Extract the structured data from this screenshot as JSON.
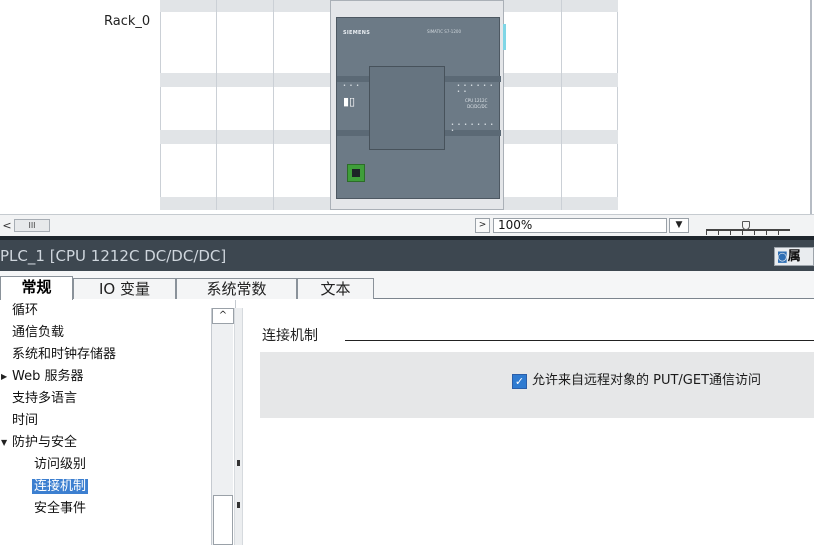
{
  "device_view": {
    "rack_label": "Rack_0",
    "cpu_module": {
      "brand": "SIEMENS",
      "series": "SIMATIC S7-1200",
      "model_line1": "CPU 1212C",
      "model_line2": "DC/DC/DC",
      "icon": "plc-module-icon"
    }
  },
  "scroll_bar": {
    "left_arrow": "<",
    "thumb_label": "III",
    "right_arrow": ">",
    "zoom_value": "100%",
    "zoom_dropdown_arrow": "▼",
    "zoom_slider_fraction": 0.45
  },
  "inspector": {
    "title": "PLC_1 [CPU 1212C DC/DC/DC]",
    "properties_button_label": "属",
    "tabs": [
      {
        "label": "常规",
        "active": true
      },
      {
        "label": "IO 变量",
        "active": false
      },
      {
        "label": "系统常数",
        "active": false
      },
      {
        "label": "文本",
        "active": false
      }
    ],
    "nav_items": [
      {
        "label": "循环",
        "expandable": false,
        "selected": false
      },
      {
        "label": "通信负载",
        "expandable": false,
        "selected": false
      },
      {
        "label": "系统和时钟存储器",
        "expandable": false,
        "selected": false
      },
      {
        "label": "Web 服务器",
        "expandable": true,
        "expanded": false,
        "selected": false
      },
      {
        "label": "支持多语言",
        "expandable": false,
        "selected": false
      },
      {
        "label": "时间",
        "expandable": false,
        "selected": false
      },
      {
        "label": "防护与安全",
        "expandable": true,
        "expanded": true,
        "selected": false
      },
      {
        "label": "访问级别",
        "expandable": false,
        "selected": false
      },
      {
        "label": "连接机制",
        "expandable": false,
        "selected": true
      },
      {
        "label": "安全事件",
        "expandable": false,
        "selected": false
      }
    ],
    "nav_scroll_up": "^",
    "section": {
      "title": "连接机制",
      "checkbox_checked": true,
      "checkbox_label": "允许来自远程对象的 PUT/GET通信访问"
    }
  },
  "colors": {
    "inspector_title_bar": "#3d4750",
    "selection": "#3c7fd0",
    "section_background": "#e6e7e8",
    "cpu_body": "#6c7a86",
    "port_green": "#3f9e3a"
  }
}
